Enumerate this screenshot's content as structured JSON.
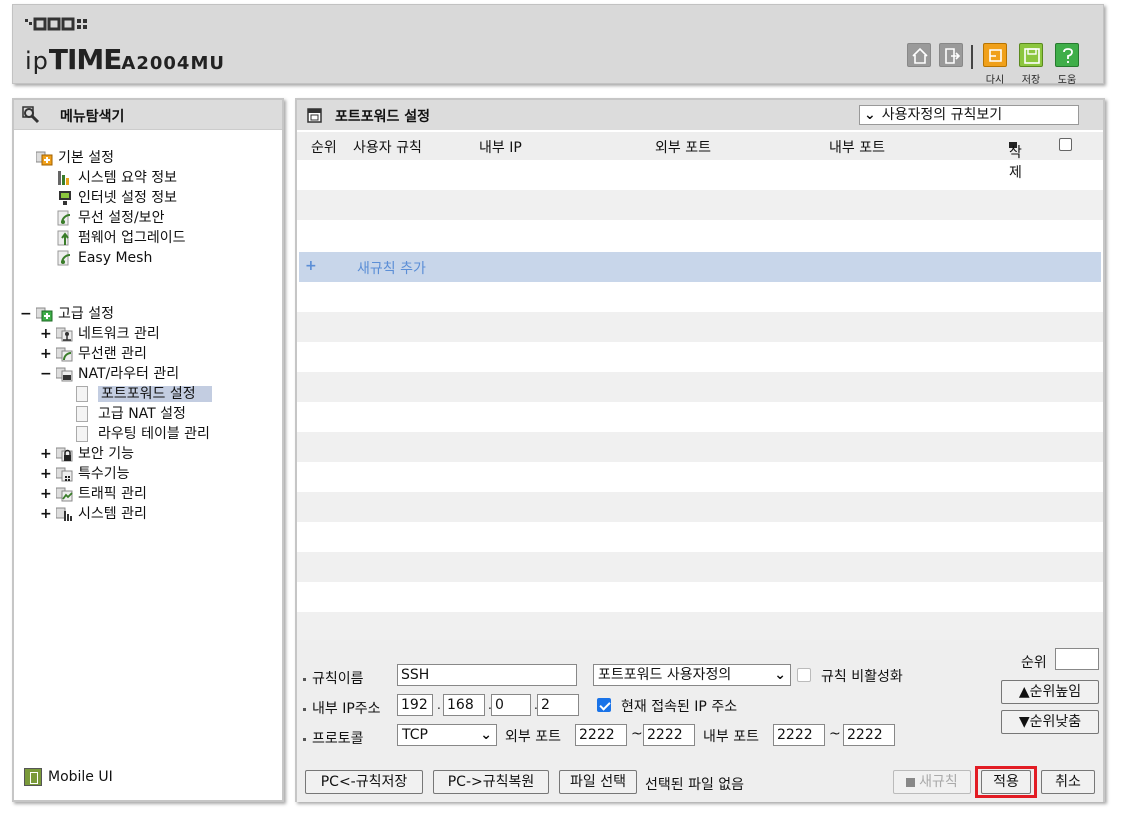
{
  "header": {
    "brand_ip": "ip",
    "brand_time": "TIME",
    "model": "A2004MU",
    "actions": [
      {
        "name": "home-icon",
        "label": ""
      },
      {
        "name": "logout-icon",
        "label": ""
      },
      {
        "name": "restart-icon",
        "label": "다시"
      },
      {
        "name": "save-icon",
        "label": "저장"
      },
      {
        "name": "help-icon",
        "label": "도움"
      }
    ]
  },
  "sidebar": {
    "title": "메뉴탐색기",
    "basic": {
      "label": "기본 설정",
      "items": [
        "시스템 요약 정보",
        "인터넷 설정 정보",
        "무선 설정/보안",
        "펌웨어 업그레이드",
        "Easy Mesh"
      ]
    },
    "advanced": {
      "label": "고급 설정",
      "items": [
        "네트워크 관리",
        "무선랜 관리",
        "NAT/라우터 관리"
      ],
      "nat_children": [
        "포트포워드 설정",
        "고급 NAT 설정",
        "라우팅 테이블 관리"
      ],
      "items_after": [
        "보안 기능",
        "특수기능",
        "트래픽 관리",
        "시스템 관리"
      ]
    },
    "mobile_ui": "Mobile UI"
  },
  "main": {
    "title": "포트포워드 설정",
    "view_select": "사용자정의 규칙보기",
    "columns": [
      "순위",
      "사용자 규칙",
      "내부 IP",
      "외부 포트",
      "내부 포트",
      "삭제"
    ],
    "add_rule": "새규칙 추가",
    "form": {
      "rank_label": "순위",
      "rank_value": "",
      "rule_name_label": "규칙이름",
      "rule_name": "SSH",
      "rule_type": "포트포워드 사용자정의",
      "disable_label": "규칙 비활성화",
      "disable_checked": false,
      "ip_label": "내부 IP주소",
      "ip": [
        "192",
        "168",
        "0",
        "2"
      ],
      "use_current_label": "현재 접속된 IP 주소",
      "use_current_checked": true,
      "protocol_label": "프로토콜",
      "protocol": "TCP",
      "ext_port_label": "외부 포트",
      "ext_port_from": "2222",
      "ext_port_to": "2222",
      "int_port_label": "내부 포트",
      "int_port_from": "2222",
      "int_port_to": "2222",
      "tilde": "~",
      "move_up": "순위높임",
      "move_down": "순위낮춤"
    },
    "buttons": {
      "pc_save": "PC<-규칙저장",
      "pc_restore": "PC->규칙복원",
      "file_select": "파일 선택",
      "no_file": "선택된 파일 없음",
      "new_rule": "새규칙",
      "apply": "적용",
      "cancel": "취소"
    }
  },
  "colors": {
    "apply_highlight": "#e21c24",
    "add_row_bg": "#c8d6ea",
    "add_row_text": "#5b8ed6",
    "selected_item": "#c3cde1"
  }
}
